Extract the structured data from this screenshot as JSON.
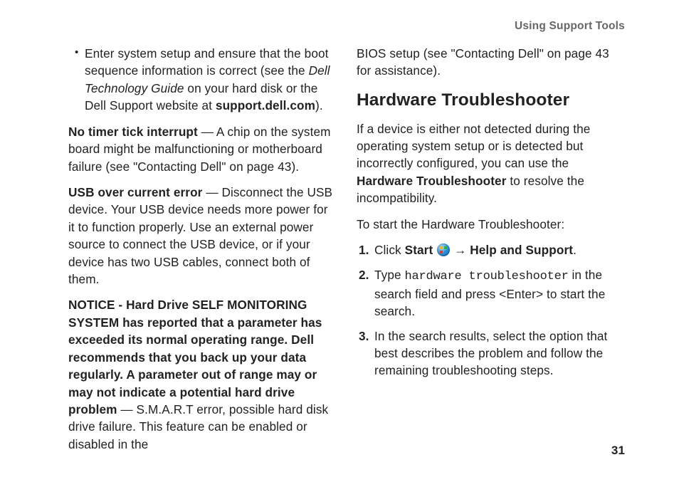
{
  "running_head": "Using Support Tools",
  "page_number": "31",
  "left_column": {
    "bullet": {
      "pre": "Enter system setup and ensure that the boot sequence information is correct (see the ",
      "italic": "Dell Technology Guide",
      "mid": " on your hard disk or the Dell Support website at ",
      "bold": "support.dell.com",
      "post": ")."
    },
    "p_no_timer": {
      "bold": "No timer tick interrupt",
      "rest": " — A chip on the system board might be malfunctioning or motherboard failure (see \"Contacting Dell\" on page 43)."
    },
    "p_usb": {
      "bold": "USB over current error",
      "rest": " — Disconnect the USB device. Your USB device needs more power for it to function properly. Use an external power source to connect the USB device, or if your device has two USB cables, connect both of them."
    },
    "p_notice": {
      "bold": "NOTICE - Hard Drive SELF MONITORING SYSTEM has reported that a parameter has exceeded its normal operating range. Dell recommends that you back up your data regularly. A parameter out of range may or may not indicate a potential hard drive problem",
      "rest": " — S.M.A.R.T error, possible hard disk drive failure. This feature can be enabled or disabled in the"
    }
  },
  "right_column": {
    "p_cont": "BIOS setup (see \"Contacting Dell\" on page 43 for assistance).",
    "heading": "Hardware Troubleshooter",
    "p_intro_pre": "If a device is either not detected during the operating system setup or is detected but incorrectly configured, you can use the ",
    "p_intro_bold": "Hardware Troubleshooter",
    "p_intro_post": " to resolve the incompatibility.",
    "p_start": "To start the Hardware Troubleshooter:",
    "step1_pre": "Click ",
    "step1_b1": "Start",
    "step1_mid": " ",
    "step1_arrow": " → ",
    "step1_b2": "Help and Support",
    "step1_post": ".",
    "step2_pre": "Type ",
    "step2_code": "hardware troubleshooter",
    "step2_post": " in the search field and press <Enter> to start the search.",
    "step3": "In the search results, select the option that best describes the problem and follow the remaining troubleshooting steps."
  }
}
